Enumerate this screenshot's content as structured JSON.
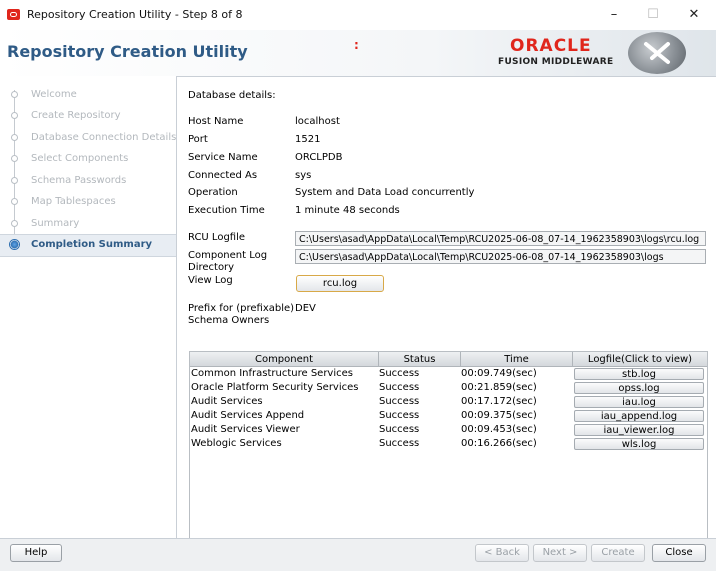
{
  "window": {
    "title": "Repository Creation Utility - Step 8 of 8",
    "minimize": "–",
    "maximize": "☐",
    "close": "✕"
  },
  "header": {
    "app_title": "Repository Creation Utility",
    "brand": "ORACLE",
    "brand_sub": "FUSION MIDDLEWARE",
    "accent_color": "#e0261c",
    "title_color": "#2f5b86"
  },
  "nav": {
    "items": [
      {
        "label": "Welcome",
        "active": false
      },
      {
        "label": "Create Repository",
        "active": false
      },
      {
        "label": "Database Connection Details",
        "active": false
      },
      {
        "label": "Select Components",
        "active": false
      },
      {
        "label": "Schema Passwords",
        "active": false
      },
      {
        "label": "Map Tablespaces",
        "active": false
      },
      {
        "label": "Summary",
        "active": false
      },
      {
        "label": "Completion Summary",
        "active": true
      }
    ]
  },
  "details": {
    "section_title": "Database details:",
    "host_label": "Host Name",
    "host_value": "localhost",
    "port_label": "Port",
    "port_value": "1521",
    "service_label": "Service Name",
    "service_value": "ORCLPDB",
    "connected_label": "Connected As",
    "connected_value": "sys",
    "operation_label": "Operation",
    "operation_value": "System and Data Load concurrently",
    "exec_label": "Execution Time",
    "exec_value": "1  minute 48  seconds",
    "rcu_log_label": "RCU Logfile",
    "rcu_log_value": "C:\\Users\\asad\\AppData\\Local\\Temp\\RCU2025-06-08_07-14_1962358903\\logs\\rcu.log",
    "comp_log_label_1": "Component Log",
    "comp_log_label_2": "Directory",
    "comp_log_value": "C:\\Users\\asad\\AppData\\Local\\Temp\\RCU2025-06-08_07-14_1962358903\\logs",
    "view_log_label": "View Log",
    "view_log_button": "rcu.log",
    "prefix_label_1": "Prefix for (prefixable)",
    "prefix_label_2": "Schema Owners",
    "prefix_value": "DEV"
  },
  "table": {
    "headers": [
      "Component",
      "Status",
      "Time",
      "Logfile(Click to view)"
    ],
    "rows": [
      {
        "component": "Common Infrastructure Services",
        "status": "Success",
        "time": "00:09.749(sec)",
        "log": "stb.log"
      },
      {
        "component": "Oracle Platform Security Services",
        "status": "Success",
        "time": "00:21.859(sec)",
        "log": "opss.log"
      },
      {
        "component": "Audit Services",
        "status": "Success",
        "time": "00:17.172(sec)",
        "log": "iau.log"
      },
      {
        "component": "Audit Services Append",
        "status": "Success",
        "time": "00:09.375(sec)",
        "log": "iau_append.log"
      },
      {
        "component": "Audit Services Viewer",
        "status": "Success",
        "time": "00:09.453(sec)",
        "log": "iau_viewer.log"
      },
      {
        "component": "Weblogic Services",
        "status": "Success",
        "time": "00:16.266(sec)",
        "log": "wls.log"
      }
    ]
  },
  "footer": {
    "help": "Help",
    "back": "< Back",
    "next": "Next >",
    "create": "Create",
    "close": "Close"
  }
}
